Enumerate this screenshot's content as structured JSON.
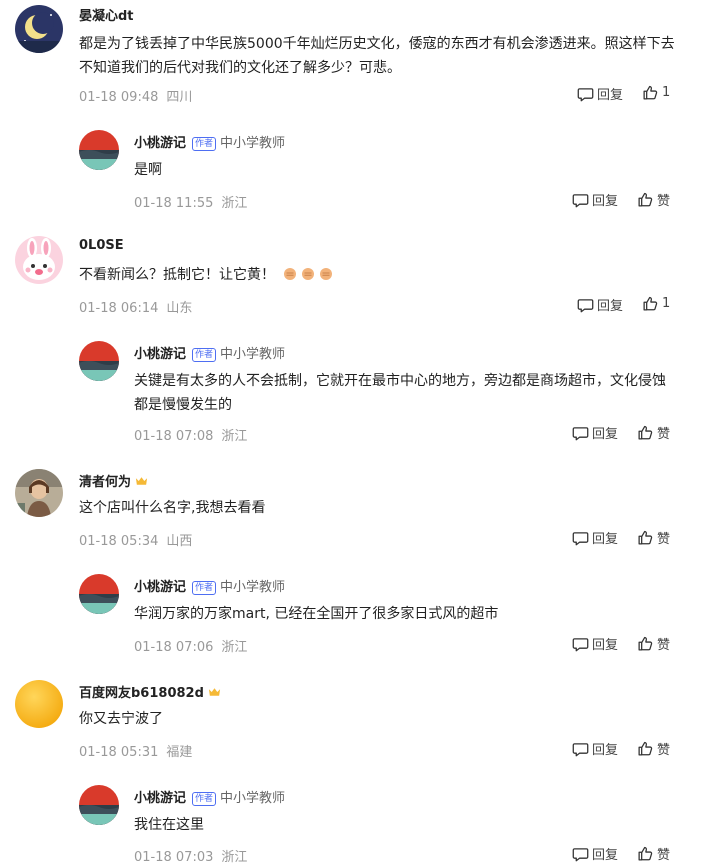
{
  "icons": {
    "reply": "comment-bubble-icon",
    "like": "thumbs-up-icon",
    "crown": "crown-icon",
    "author_badge": "author-badge"
  },
  "comments": [
    {
      "user": "晏凝心dt",
      "text": "都是为了钱丢掉了中华民族5000千年灿烂历史文化，倭寇的东西才有机会渗透进来。照这样下去不知道我们的后代对我们的文化还了解多少？可悲。",
      "time": "01-18 09:48",
      "location": "四川",
      "reply_label": "回复",
      "like_label": "1",
      "reply": {
        "user": "小桃游记",
        "badge": "作者",
        "title": "中小学教师",
        "text": "是啊",
        "time": "01-18 11:55",
        "location": "浙江",
        "reply_label": "回复",
        "like_label": "赞"
      }
    },
    {
      "user": "0L0SE",
      "text": "不看新闻么？抵制它！让它黄！",
      "time": "01-18 06:14",
      "location": "山东",
      "reply_label": "回复",
      "like_label": "1",
      "reply": {
        "user": "小桃游记",
        "badge": "作者",
        "title": "中小学教师",
        "text": "关键是有太多的人不会抵制，它就开在最市中心的地方，旁边都是商场超市，文化侵蚀都是慢慢发生的",
        "time": "01-18 07:08",
        "location": "浙江",
        "reply_label": "回复",
        "like_label": "赞"
      }
    },
    {
      "user": "清者何为",
      "text": "这个店叫什么名字,我想去看看",
      "time": "01-18 05:34",
      "location": "山西",
      "reply_label": "回复",
      "like_label": "赞",
      "reply": {
        "user": "小桃游记",
        "badge": "作者",
        "title": "中小学教师",
        "text": "华润万家的万家mart, 已经在全国开了很多家日式风的超市",
        "time": "01-18 07:06",
        "location": "浙江",
        "reply_label": "回复",
        "like_label": "赞"
      }
    },
    {
      "user": "百度网友b618082d",
      "text": "你又去宁波了",
      "time": "01-18 05:31",
      "location": "福建",
      "reply_label": "回复",
      "like_label": "赞",
      "reply": {
        "user": "小桃游记",
        "badge": "作者",
        "title": "中小学教师",
        "text": "我住在这里",
        "time": "01-18 07:03",
        "location": "浙江",
        "reply_label": "回复",
        "like_label": "赞"
      }
    }
  ]
}
